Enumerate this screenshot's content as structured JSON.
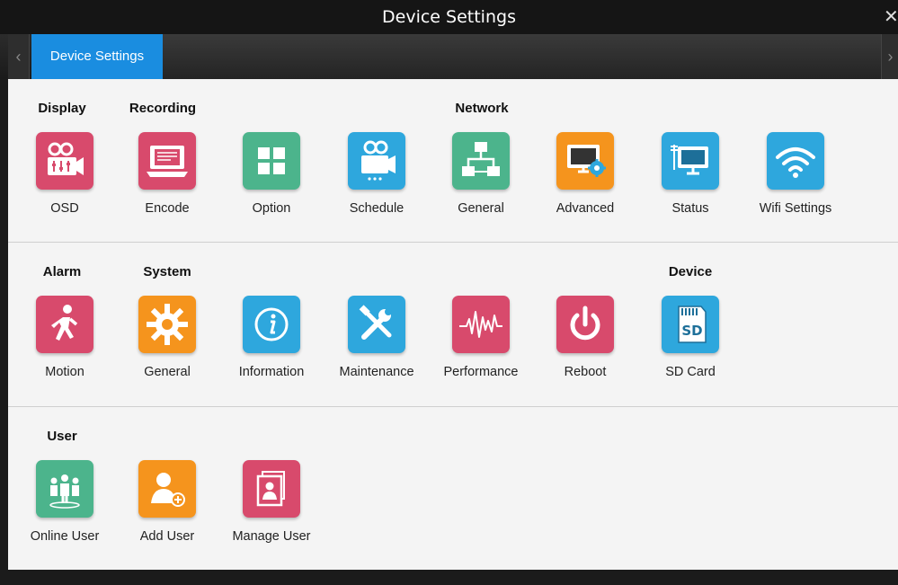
{
  "window": {
    "title": "Device Settings",
    "close_glyph": "✕"
  },
  "tabbar": {
    "prev_glyph": "‹",
    "next_glyph": "›",
    "tabs": [
      {
        "label": "Device Settings",
        "active": true
      }
    ]
  },
  "colors": {
    "pink": "#d84a6c",
    "green": "#4cb48c",
    "blue": "#2ea7dd",
    "orange": "#f5941d",
    "tab_active": "#1a8de0"
  },
  "sections": [
    {
      "headers": [
        "Display",
        "Recording",
        "Network"
      ],
      "items": [
        {
          "label": "OSD",
          "icon": "osd-camera-icon",
          "color": "pink"
        },
        {
          "label": "Encode",
          "icon": "encode-monitor-icon",
          "color": "pink"
        },
        {
          "label": "Option",
          "icon": "option-grid-icon",
          "color": "green"
        },
        {
          "label": "Schedule",
          "icon": "schedule-camera-icon",
          "color": "blue"
        },
        {
          "label": "General",
          "icon": "network-general-icon",
          "color": "green"
        },
        {
          "label": "Advanced",
          "icon": "advanced-monitor-gear-icon",
          "color": "orange"
        },
        {
          "label": "Status",
          "icon": "status-monitor-icon",
          "color": "blue"
        },
        {
          "label": "Wifi Settings",
          "icon": "wifi-icon",
          "color": "blue"
        }
      ]
    },
    {
      "headers": [
        "Alarm",
        "System",
        "Device"
      ],
      "items": [
        {
          "label": "Motion",
          "icon": "motion-runner-icon",
          "color": "pink"
        },
        {
          "label": "General",
          "icon": "gear-icon",
          "color": "orange"
        },
        {
          "label": "Information",
          "icon": "info-icon",
          "color": "blue"
        },
        {
          "label": "Maintenance",
          "icon": "tools-icon",
          "color": "blue"
        },
        {
          "label": "Performance",
          "icon": "pulse-icon",
          "color": "pink"
        },
        {
          "label": "Reboot",
          "icon": "power-icon",
          "color": "pink"
        },
        {
          "label": "SD Card",
          "icon": "sd-card-icon",
          "color": "blue",
          "glyph": "SD"
        }
      ]
    },
    {
      "headers": [
        "User"
      ],
      "items": [
        {
          "label": "Online User",
          "icon": "online-users-icon",
          "color": "green"
        },
        {
          "label": "Add User",
          "icon": "add-user-icon",
          "color": "orange"
        },
        {
          "label": "Manage User",
          "icon": "manage-user-icon",
          "color": "pink"
        }
      ]
    }
  ]
}
